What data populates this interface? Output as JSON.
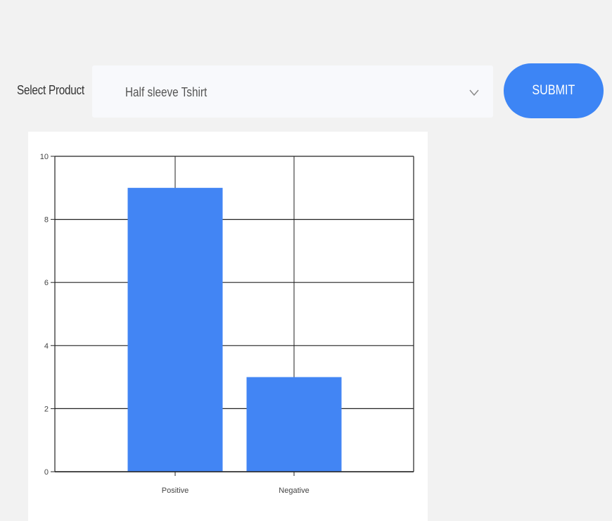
{
  "form": {
    "select_label": "Select Product",
    "selected_product": "Half sleeve Tshirt",
    "submit_label": "SUBMIT"
  },
  "icons": {
    "dropdown": "chevron-down-icon"
  },
  "colors": {
    "background": "#f2f2f2",
    "accent": "#3d85f5",
    "bar": "#4285f4",
    "select_background": "#f8f9fc"
  },
  "chart_data": {
    "type": "bar",
    "categories": [
      "Positive",
      "Negative"
    ],
    "values": [
      9,
      3
    ],
    "title": "",
    "xlabel": "",
    "ylabel": "",
    "ylim": [
      0,
      10
    ],
    "yticks": [
      0,
      2,
      4,
      6,
      8,
      10
    ],
    "grid": true,
    "legend": "none"
  }
}
